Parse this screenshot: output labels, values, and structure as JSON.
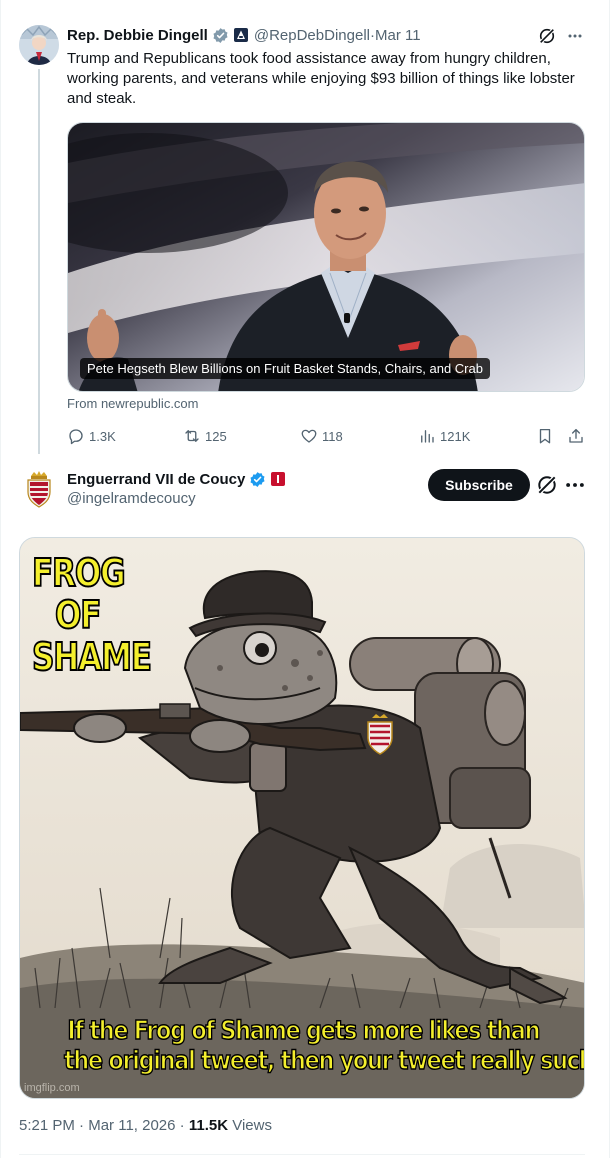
{
  "quoted_tweet": {
    "author_name": "Rep. Debbie Dingell",
    "handle": "@RepDebDingell",
    "separator": " · ",
    "date": "Mar 11",
    "text": "Trump and Republicans took food assistance away from hungry children, working parents, and veterans while enjoying $93 billion of things like lobster and steak.",
    "card": {
      "headline": "Pete Hegseth Blew Billions on Fruit Basket Stands, Chairs, and Crab",
      "source": "From newrepublic.com"
    },
    "actions": {
      "replies": "1.3K",
      "reposts": "125",
      "likes": "118",
      "views": "121K"
    }
  },
  "main_tweet": {
    "author_name": "Enguerrand VII de Coucy",
    "handle": "@ingelramdecoucy",
    "subscribe_label": "Subscribe",
    "meme": {
      "top_text": [
        "FROG",
        "OF",
        "SHAME"
      ],
      "bottom_text": [
        "If the Frog of Shame gets more likes than",
        "the original tweet, then your tweet really sucks"
      ],
      "watermark": "imgflip.com"
    },
    "time": "5:21 PM",
    "separator": " · ",
    "date": "Mar 11, 2026",
    "views_count": "11.5K",
    "views_label": " Views"
  },
  "colors": {
    "verified_blue": "#1d9bf0",
    "text_primary": "#0f1419",
    "text_secondary": "#536471",
    "meme_text_yellow": "#f4ef2d",
    "affiliate_red": "#c8102e"
  },
  "icons": [
    "verified-badge-icon",
    "affiliation-badge-icon",
    "grok-icon",
    "more-icon",
    "reply-icon",
    "repost-icon",
    "like-icon",
    "views-icon",
    "bookmark-icon",
    "share-icon"
  ]
}
